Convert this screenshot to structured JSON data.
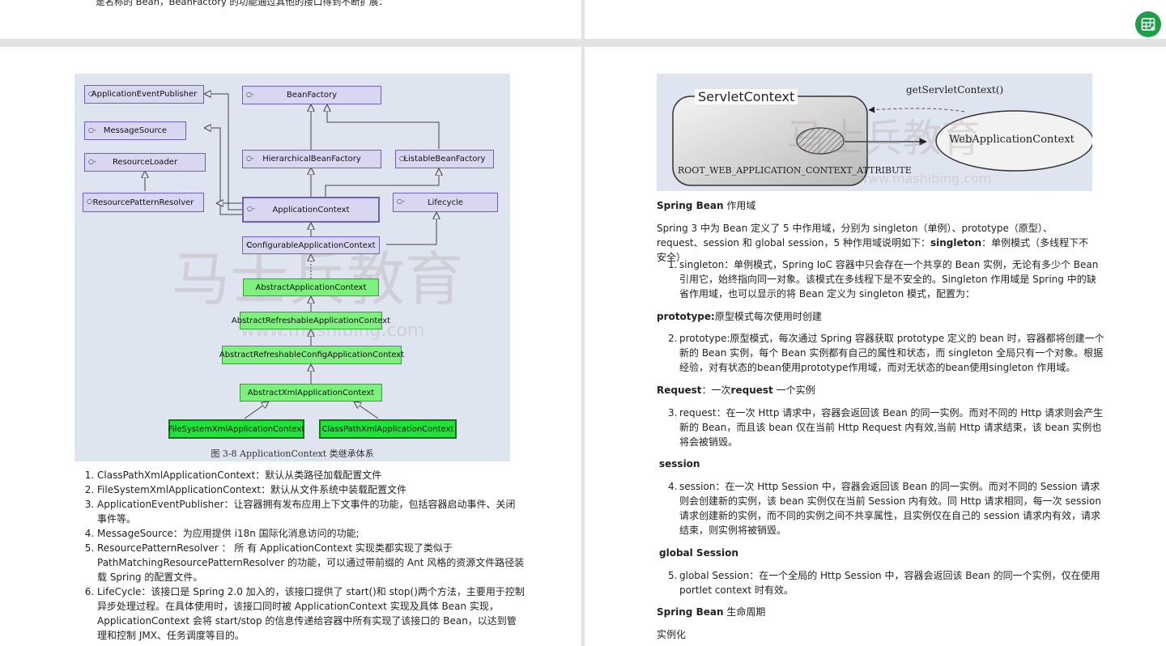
{
  "top_left_text": "是名称的 Bean，BeanFactory 的功能通过其他的接口得到不断扩展：",
  "diagram": {
    "boxes": {
      "publisher": "ApplicationEventPublisher",
      "message": "MessageSource",
      "loader": "ResourceLoader",
      "resolver": "ResourcePatternResolver",
      "beanfactory": "BeanFactory",
      "hier": "HierarchicalBeanFactory",
      "listable": "ListableBeanFactory",
      "appctx": "ApplicationContext",
      "lifecycle": "Lifecycle",
      "config": "ConfigurableApplicationContext",
      "abstract": "AbstractApplicationContext",
      "refreshable": "AbstractRefreshableApplicationContext",
      "refreshconfig": "AbstractRefreshableConfigApplicationContext",
      "xml": "AbstractXmlApplicationContext",
      "fs": "FileSystemXmlApplicationContext",
      "cp": "ClassPathXmlApplicationContext"
    },
    "caption": "图 3-8   ApplicationContext 类继承体系",
    "watermark_cn": "马士兵教育",
    "watermark_url": "www.mashibing.com"
  },
  "left_list": [
    "ClassPathXmlApplicationContext：默认从类路径加载配置文件",
    "FileSystemXmlApplicationContext：默认从文件系统中装载配置文件",
    "ApplicationEventPublisher：让容器拥有发布应用上下文事件的功能，包括容器启动事件、关闭事件等。",
    "MessageSource：为应用提供 i18n 国际化消息访问的功能;",
    "ResourcePatternResolver ： 所 有 ApplicationContext 实现类都实现了类似于 PathMatchingResourcePatternResolver 的功能，可以通过带前缀的 Ant 风格的资源文件路径装载 Spring 的配置文件。",
    "LifeCycle：该接口是 Spring 2.0 加入的，该接口提供了 start()和 stop()两个方法，主要用于控制异步处理过程。在具体使用时，该接口同时被 ApplicationContext 实现及具体 Bean 实现，ApplicationContext 会将 start/stop 的信息传递给容器中所有实现了该接口的 Bean，以达到管理和控制 JMX、任务调度等目的。"
  ],
  "servlet_diagram": {
    "servlet_context": "ServletContext",
    "get_call": "getServletContext()",
    "web_context": "WebApplicationContext",
    "attribute": "ROOT_WEB_APPLICATION_CONTEXT_ATTRIBUTE"
  },
  "right": {
    "scope_heading_bold": "Spring Bean",
    "scope_heading_rest": " 作用域",
    "scope_intro": "Spring 3 中为 Bean 定义了 5 中作用域，分别为 singleton（单例）、prototype（原型）、request、session 和 global session，5 种作用域说明如下：",
    "scope_intro_bold": "singleton",
    "scope_intro_tail": "：单例模式（多线程下不安全）",
    "item1": "singleton：单例模式，Spring IoC 容器中只会存在一个共享的 Bean 实例，无论有多少个 Bean 引用它，始终指向同一对象。该模式在多线程下是不安全的。Singleton 作用域是 Spring 中的缺省作用域，也可以显示的将 Bean 定义为 singleton 模式，配置为：",
    "prototype_heading_bold": "prototype:",
    "prototype_heading_rest": "原型模式每次使用时创建",
    "item2": "prototype:原型模式，每次通过 Spring 容器获取 prototype 定义的 bean 时，容器都将创建一个新的 Bean 实例，每个 Bean 实例都有自己的属性和状态，而 singleton 全局只有一个对象。根据经验，对有状态的bean使用prototype作用域，而对无状态的bean使用singleton 作用域。",
    "request_heading_bold": "Request",
    "request_heading_mid": "：一次",
    "request_heading_bold2": "request",
    "request_heading_rest": " 一个实例",
    "item3": "request：在一次 Http 请求中，容器会返回该 Bean 的同一实例。而对不同的 Http 请求则会产生新的 Bean，而且该 bean 仅在当前 Http Request 内有效,当前 Http 请求结束，该 bean 实例也将会被销毁。",
    "session_heading": "session",
    "item4": "session：在一次 Http Session 中，容器会返回该 Bean 的同一实例。而对不同的 Session 请求则会创建新的实例，该 bean 实例仅在当前 Session 内有效。同 Http 请求相同，每一次 session 请求创建新的实例，而不同的实例之间不共享属性，且实例仅在自己的 session 请求内有效，请求结束，则实例将被销毁。",
    "global_heading": "global Session",
    "item5": "global Session：在一个全局的 Http Session 中，容器会返回该 Bean 的同一个实例，仅在使用 portlet context 时有效。",
    "lifecycle_heading_bold": "Spring Bean",
    "lifecycle_heading_rest": " 生命周期",
    "instantiate": "实例化"
  },
  "nums": {
    "n1": "1.",
    "n2": "2.",
    "n3": "3.",
    "n4": "4.",
    "n5": "5."
  },
  "fab_icon": "table-grid-icon"
}
